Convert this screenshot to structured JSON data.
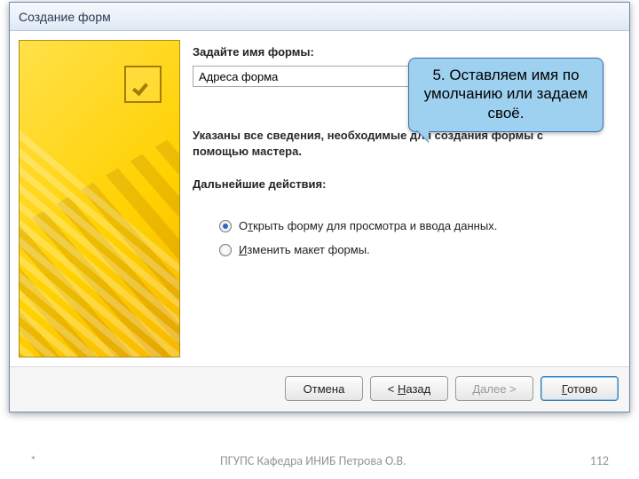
{
  "dialog": {
    "title": "Создание форм",
    "form_name_label": "Задайте имя формы:",
    "form_name_value": "Адреса форма",
    "desc": "Указаны все сведения, необходимые для создания формы с помощью мастера.",
    "actions_label": "Дальнейшие действия:",
    "radio_open": {
      "pre": "О",
      "mn": "т",
      "post": "крыть форму для просмотра и ввода данных."
    },
    "radio_modify": {
      "pre": "",
      "mn": "И",
      "post": "зменить макет формы."
    },
    "radio_selected": "open"
  },
  "callout": "5. Оставляем имя по умолчанию или задаем своё.",
  "buttons": {
    "cancel": {
      "pre": "Отмена",
      "mn": "",
      "post": ""
    },
    "back": {
      "pre": "< ",
      "mn": "Н",
      "post": "азад"
    },
    "next": {
      "pre": "",
      "mn": "Д",
      "post": "алее >"
    },
    "finish": {
      "pre": "",
      "mn": "Г",
      "post": "отово"
    }
  },
  "footer": {
    "left": "*",
    "center": "ПГУПС   Кафедра   ИНИБ   Петрова О.В.",
    "right": "112"
  }
}
